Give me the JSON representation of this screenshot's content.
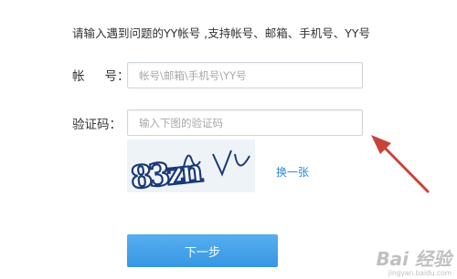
{
  "intro_text": "请输入遇到问题的YY帐号 ,支持帐号、邮箱、手机号、YY号",
  "account": {
    "label_part1": "帐",
    "label_part2": "号：",
    "placeholder": "帐号\\邮箱\\手机号\\YY号"
  },
  "captcha": {
    "label": "验证码：",
    "placeholder": "输入下图的验证码",
    "image_text": "83zn",
    "refresh_label": "换一张"
  },
  "next_button_label": "下一步",
  "watermark": {
    "brand": "Bai 经验",
    "url": "jingyan.baidu.com"
  },
  "colors": {
    "link": "#2a8ad8",
    "button": "#3d9be6",
    "annotation_arrow": "#c9433a"
  }
}
